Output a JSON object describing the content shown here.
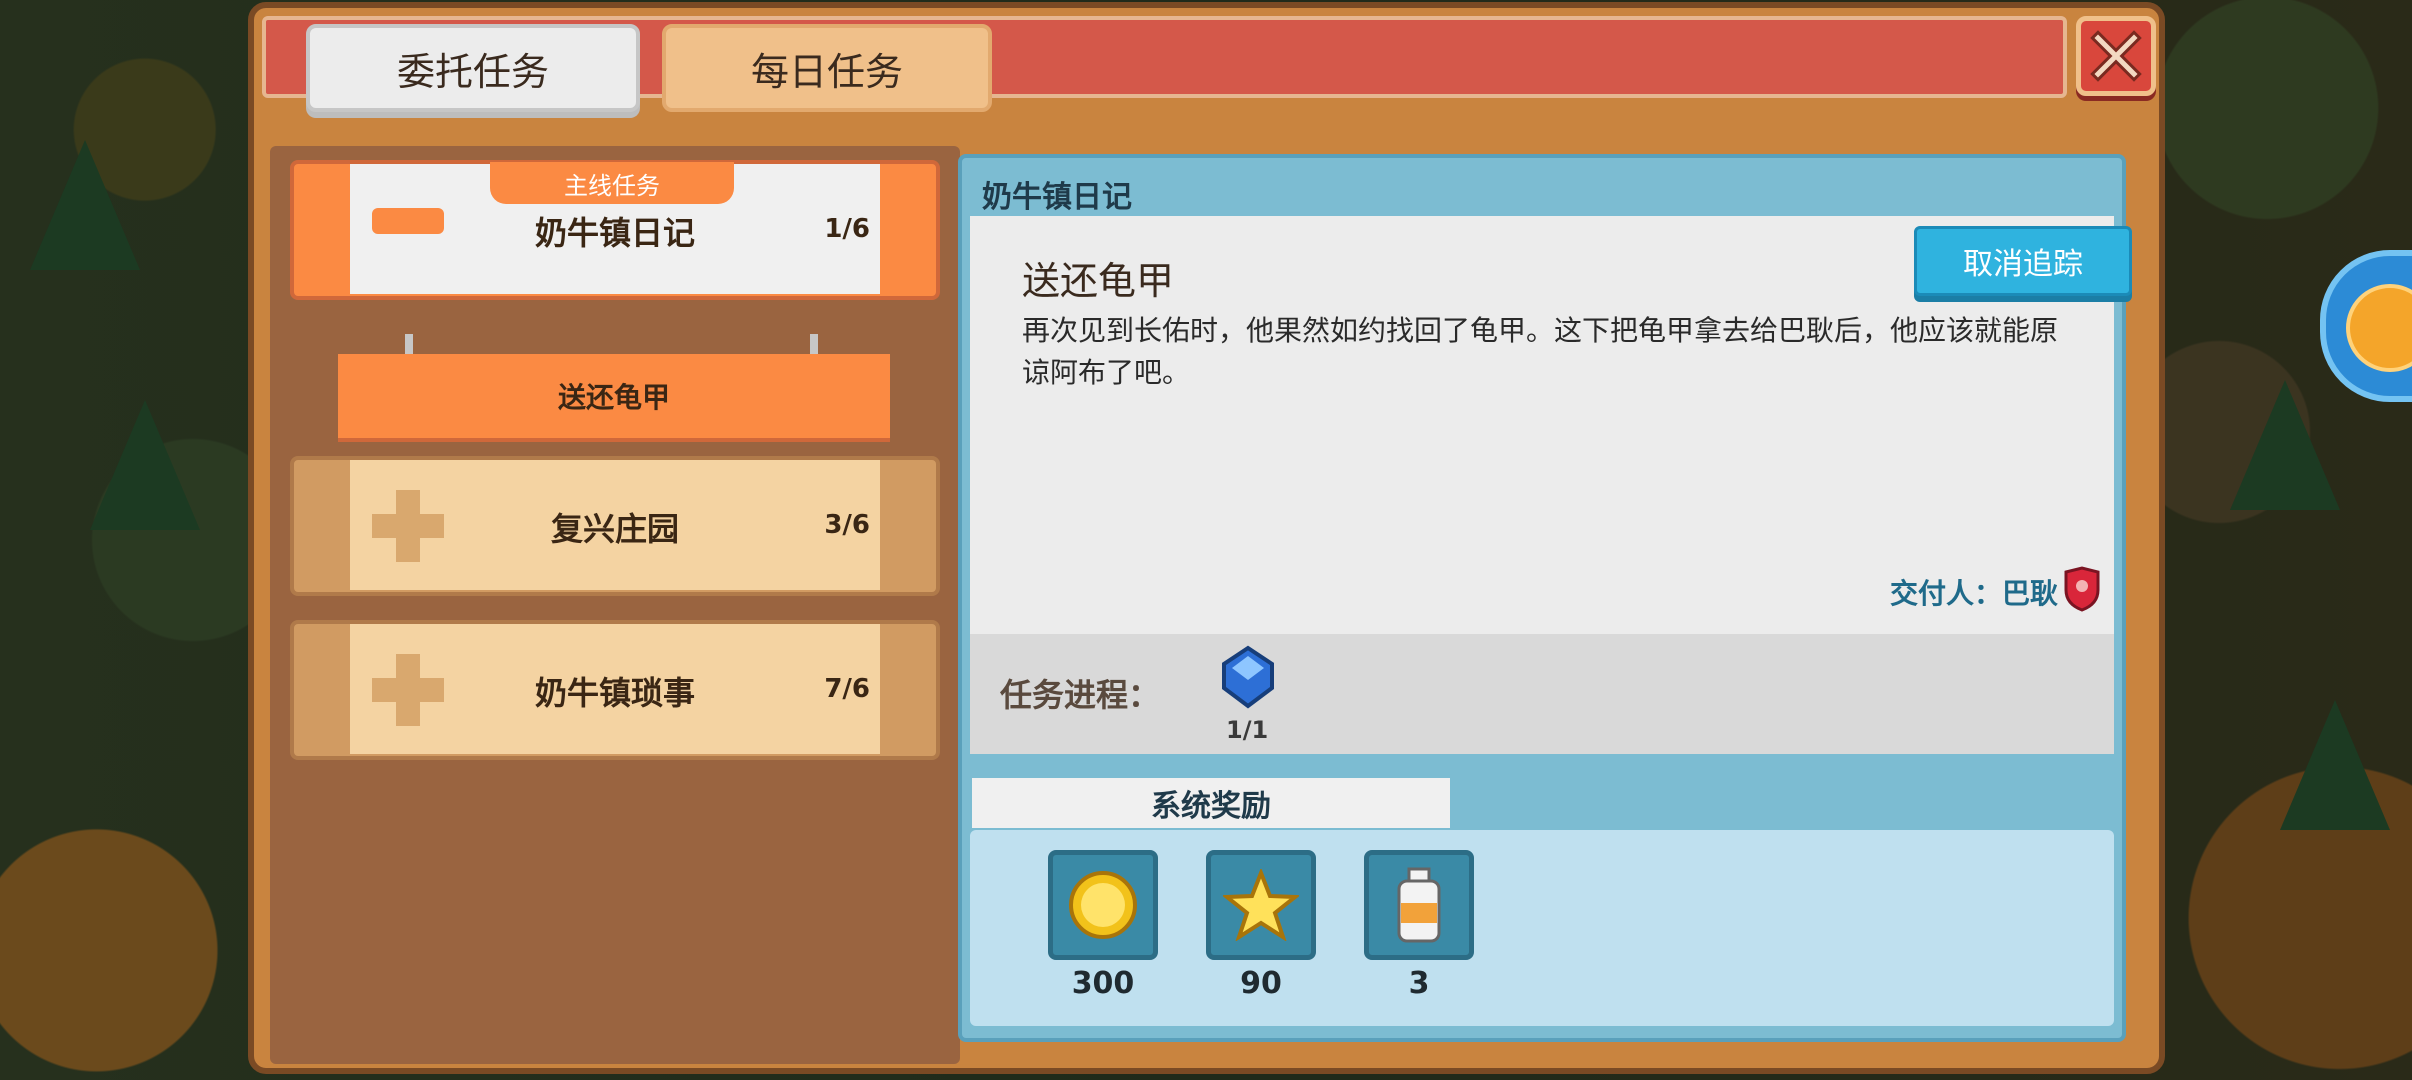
{
  "tabs": {
    "active": "委托任务",
    "inactive": "每日任务"
  },
  "quests": [
    {
      "tag": "主线任务",
      "name": "奶牛镇日记",
      "count": "1/6"
    },
    {
      "name": "复兴庄园",
      "count": "3/6"
    },
    {
      "name": "奶牛镇琐事",
      "count": "7/6"
    }
  ],
  "sub_quest": "送还龟甲",
  "detail": {
    "header": "奶牛镇日记",
    "title": "送还龟甲",
    "cancel_label": "取消追踪",
    "description": "再次见到长佑时，他果然如约找回了龟甲。这下把龟甲拿去给巴耿后，他应该就能原谅阿布了吧。",
    "giver": "交付人：巴耿",
    "progress_label": "任务进程：",
    "progress_value": "1/1"
  },
  "rewards": {
    "tab": "系统奖励",
    "items": [
      {
        "icon": "gold-coin-icon",
        "amount": "300"
      },
      {
        "icon": "star-icon",
        "amount": "90"
      },
      {
        "icon": "milk-bottle-icon",
        "amount": "3"
      }
    ]
  },
  "colors": {
    "accent": "#fb8a43",
    "title_bar": "#d4584a",
    "panel_blue": "#7cbcd2"
  }
}
